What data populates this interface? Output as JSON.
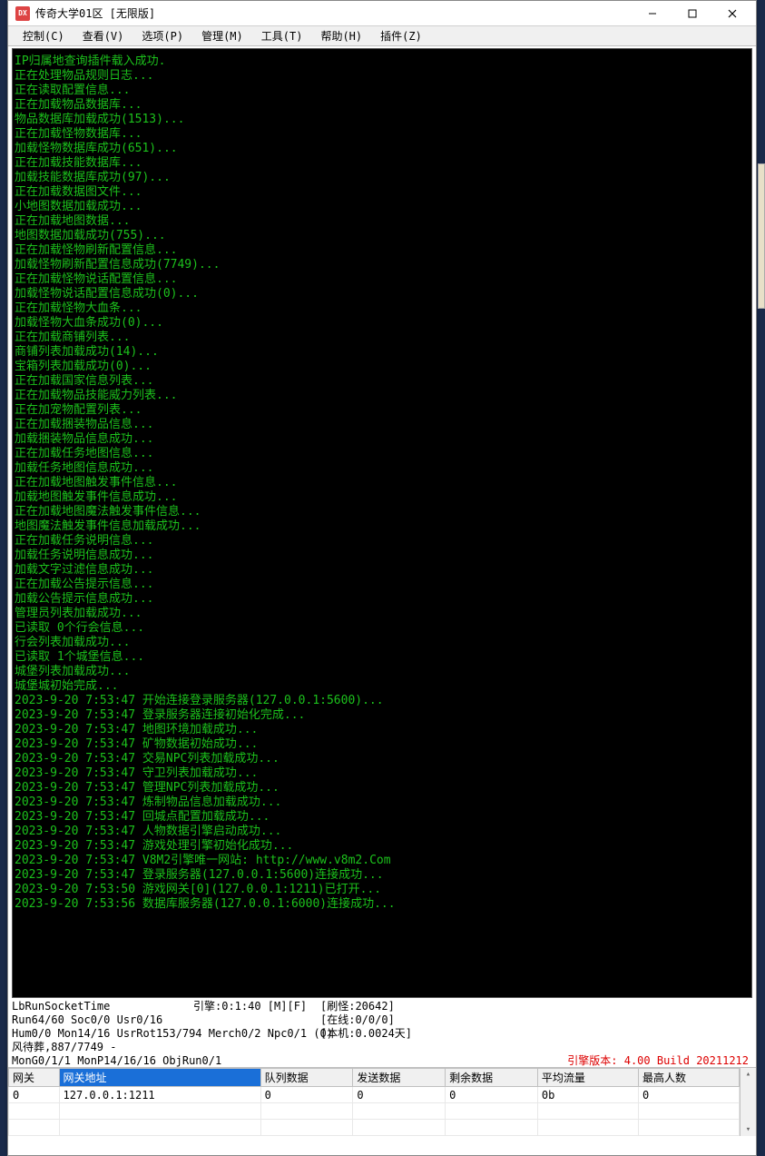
{
  "window": {
    "title": "传奇大学01区 [无限版]"
  },
  "menu": {
    "items": [
      "控制(C)",
      "查看(V)",
      "选项(P)",
      "管理(M)",
      "工具(T)",
      "帮助(H)",
      "插件(Z)"
    ]
  },
  "console_lines": [
    "IP归属地查询插件载入成功.",
    "正在处理物品规则日志...",
    "正在读取配置信息...",
    "正在加载物品数据库...",
    "物品数据库加载成功(1513)...",
    "正在加载怪物数据库...",
    "加载怪物数据库成功(651)...",
    "正在加载技能数据库...",
    "加载技能数据库成功(97)...",
    "正在加载数据图文件...",
    "小地图数据加载成功...",
    "正在加载地图数据...",
    "地图数据加载成功(755)...",
    "正在加载怪物刷新配置信息...",
    "加载怪物刷新配置信息成功(7749)...",
    "正在加载怪物说话配置信息...",
    "加载怪物说话配置信息成功(0)...",
    "正在加载怪物大血条...",
    "加载怪物大血条成功(0)...",
    "正在加载商铺列表...",
    "商铺列表加载成功(14)...",
    "宝箱列表加载成功(0)...",
    "正在加载国家信息列表...",
    "正在加载物品技能威力列表...",
    "正在加宠物配置列表...",
    "正在加载捆装物品信息...",
    "加载捆装物品信息成功...",
    "正在加载任务地图信息...",
    "加载任务地图信息成功...",
    "正在加载地图触发事件信息...",
    "加载地图触发事件信息成功...",
    "正在加载地图魔法触发事件信息...",
    "地图魔法触发事件信息加载成功...",
    "正在加载任务说明信息...",
    "加载任务说明信息成功...",
    "加载文字过滤信息成功...",
    "正在加载公告提示信息...",
    "加载公告提示信息成功...",
    "管理员列表加载成功...",
    "已读取 0个行会信息...",
    "行会列表加载成功...",
    "已读取 1个城堡信息...",
    "城堡列表加载成功...",
    "城堡城初始完成...",
    "2023-9-20 7:53:47 开始连接登录服务器(127.0.0.1:5600)...",
    "2023-9-20 7:53:47 登录服务器连接初始化完成...",
    "2023-9-20 7:53:47 地图环境加载成功...",
    "2023-9-20 7:53:47 矿物数据初始成功...",
    "2023-9-20 7:53:47 交易NPC列表加载成功...",
    "2023-9-20 7:53:47 守卫列表加载成功...",
    "2023-9-20 7:53:47 管理NPC列表加载成功...",
    "2023-9-20 7:53:47 炼制物品信息加载成功...",
    "2023-9-20 7:53:47 回城点配置加载成功...",
    "2023-9-20 7:53:47 人物数据引擎启动成功...",
    "2023-9-20 7:53:47 游戏处理引擎初始化成功...",
    "2023-9-20 7:53:47 V8M2引擎唯一网站: http://www.v8m2.Com",
    "2023-9-20 7:53:47 登录服务器(127.0.0.1:5600)连接成功...",
    "2023-9-20 7:53:50 游戏网关[0](127.0.0.1:1211)已打开...",
    "2023-9-20 7:53:56 数据库服务器(127.0.0.1:6000)连接成功..."
  ],
  "status": {
    "col1": "LbRunSocketTime\nRun64/60 Soc0/0 Usr0/16\nHum0/0 Mon14/16 UsrRot153/794 Merch0/2 Npc0/1 (0)\n风待葬,887/7749 -\nMonG0/1/1 MonP14/16/16 ObjRun0/1",
    "col2": "引擎:0:1:40 [M][F]",
    "col3": "[刷怪:20642]\n[在线:0/0/0]\n[本机:0.0024天]",
    "version": "引擎版本: 4.00 Build 20211212"
  },
  "grid": {
    "headers": [
      "网关",
      "网关地址",
      "队列数据",
      "发送数据",
      "剩余数据",
      "平均流量",
      "最高人数"
    ],
    "selected_header_index": 1,
    "rows": [
      {
        "gw": "0",
        "addr": "127.0.0.1:1211",
        "queue": "0",
        "send": "0",
        "remain": "0",
        "avg": "0b",
        "max": "0"
      },
      {
        "gw": "",
        "addr": "",
        "queue": "",
        "send": "",
        "remain": "",
        "avg": "",
        "max": ""
      },
      {
        "gw": "",
        "addr": "",
        "queue": "",
        "send": "",
        "remain": "",
        "avg": "",
        "max": ""
      }
    ]
  }
}
